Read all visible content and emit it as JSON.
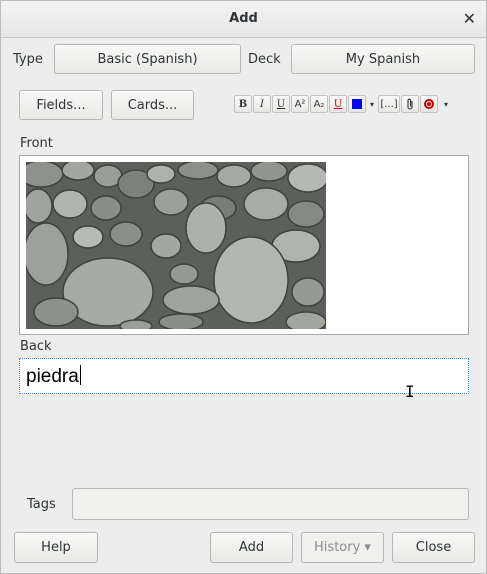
{
  "window": {
    "title": "Add"
  },
  "header": {
    "type_label": "Type",
    "type_value": "Basic (Spanish)",
    "deck_label": "Deck",
    "deck_value": "My Spanish"
  },
  "toolbar": {
    "fields_label": "Fields...",
    "cards_label": "Cards...",
    "format": {
      "bold": "B",
      "italic": "I",
      "underline": "U",
      "superscript": "A²",
      "subscript": "A₂",
      "clear_format": "U",
      "text_color": "#0000ff",
      "cloze": "[...]"
    }
  },
  "fields": {
    "front_label": "Front",
    "front_image": "pebbles-image",
    "back_label": "Back",
    "back_value": "piedra"
  },
  "tags": {
    "label": "Tags",
    "value": ""
  },
  "footer": {
    "help_label": "Help",
    "add_label": "Add",
    "history_label": "History ▾",
    "close_label": "Close"
  }
}
